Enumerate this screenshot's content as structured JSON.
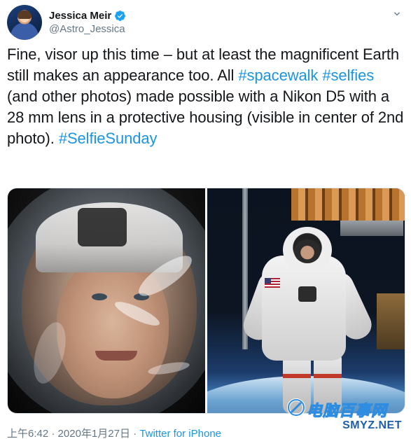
{
  "author": {
    "display_name": "Jessica Meir",
    "handle": "@Astro_Jessica",
    "verified": true
  },
  "tweet": {
    "segments": [
      {
        "text": "Fine, visor up this time – but at least the magnificent Earth still makes an appearance too. All ",
        "type": "text"
      },
      {
        "text": "#spacewalk",
        "type": "hashtag"
      },
      {
        "text": " ",
        "type": "text"
      },
      {
        "text": "#selfies",
        "type": "hashtag"
      },
      {
        "text": " (and other photos) made possible with a Nikon D5 with a 28 mm lens in a protective housing (visible in center of 2nd photo). ",
        "type": "text"
      },
      {
        "text": "#SelfieSunday",
        "type": "hashtag"
      }
    ]
  },
  "media": {
    "photos": [
      {
        "icon": "helmet-selfie-photo"
      },
      {
        "icon": "spacewalk-astronaut-photo"
      }
    ]
  },
  "meta": {
    "time": "上午6:42",
    "separator": " · ",
    "date": "2020年1月27日",
    "separator2": " · ",
    "source": "Twitter for iPhone"
  },
  "watermark": {
    "cn": "电脑百事网",
    "en": "SMYZ.NET"
  },
  "colors": {
    "link": "#1b95e0",
    "text": "#14171a",
    "secondary": "#657786",
    "verified": "#1da1f2"
  }
}
